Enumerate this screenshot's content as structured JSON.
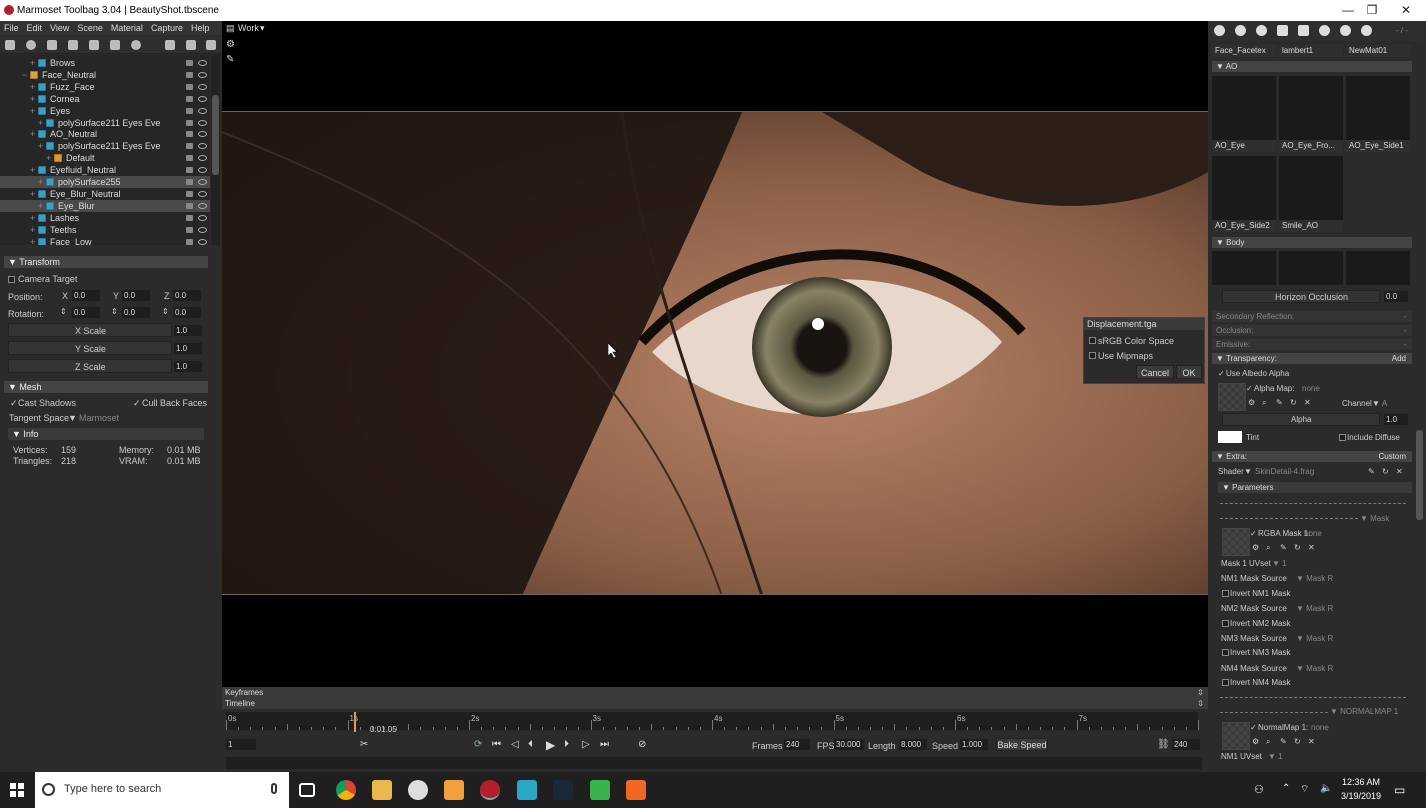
{
  "window": {
    "title": "Marmoset Toolbag 3.04  |  BeautyShot.tbscene",
    "controls": [
      "—",
      "❐",
      "✕"
    ]
  },
  "menu": [
    "File",
    "Edit",
    "View",
    "Scene",
    "Material",
    "Capture",
    "Help"
  ],
  "outliner": {
    "rows": [
      {
        "label": "Brows",
        "type": "mesh",
        "indent": 1,
        "selected": false
      },
      {
        "label": "Face_Neutral",
        "type": "folder",
        "indent": 0,
        "selected": false
      },
      {
        "label": "Fuzz_Face",
        "type": "mesh",
        "indent": 1,
        "selected": false
      },
      {
        "label": "Cornea",
        "type": "mesh",
        "indent": 1,
        "selected": false
      },
      {
        "label": "Eyes",
        "type": "mesh",
        "indent": 1,
        "selected": false
      },
      {
        "label": "polySurface211 Eyes Eve",
        "type": "mesh",
        "indent": 2,
        "selected": false
      },
      {
        "label": "AO_Neutral",
        "type": "mesh",
        "indent": 1,
        "selected": false
      },
      {
        "label": "polySurface211 Eyes Eve",
        "type": "mesh",
        "indent": 2,
        "selected": false
      },
      {
        "label": "Default",
        "type": "mat",
        "indent": 3,
        "selected": false
      },
      {
        "label": "Eyefluid_Neutral",
        "type": "mesh",
        "indent": 1,
        "selected": false
      },
      {
        "label": "polySurface255",
        "type": "mesh",
        "indent": 2,
        "selected": true
      },
      {
        "label": "Eye_Blur_Neutral",
        "type": "mesh",
        "indent": 1,
        "selected": false
      },
      {
        "label": "Eye_Blur",
        "type": "mesh",
        "indent": 2,
        "selected": true
      },
      {
        "label": "Lashes",
        "type": "mesh",
        "indent": 1,
        "selected": false
      },
      {
        "label": "Teeths",
        "type": "mesh",
        "indent": 1,
        "selected": false
      },
      {
        "label": "Face_Low",
        "type": "mesh",
        "indent": 1,
        "selected": false
      }
    ]
  },
  "transform": {
    "header": "Transform",
    "camera_target": "Camera Target",
    "position_label": "Position:",
    "rotation_label": "Rotation:",
    "x": "X",
    "y": "Y",
    "z": "Z",
    "pos": [
      "0.0",
      "0.0",
      "0.0"
    ],
    "rot": [
      "0.0",
      "0.0",
      "0.0"
    ],
    "xscale_label": "X Scale",
    "xscale": "1.0",
    "yscale_label": "Y Scale",
    "yscale": "1.0",
    "zscale_label": "Z Scale",
    "zscale": "1.0"
  },
  "mesh": {
    "header": "Mesh",
    "cast_shadows": "Cast Shadows",
    "cull_back_faces": "Cull Back Faces",
    "tangent_label": "Tangent Space",
    "tangent_value": "Marmoset",
    "info_header": "Info",
    "vertices_label": "Vertices:",
    "vertices": "159",
    "memory_label": "Memory:",
    "memory": "0.01 MB",
    "triangles_label": "Triangles:",
    "triangles": "218",
    "vram_label": "VRAM:",
    "vram": "0.01 MB"
  },
  "viewport": {
    "camera_menu": "Work"
  },
  "displacement_dialog": {
    "title": "Displacement.tga",
    "srgb": "sRGB Color Space",
    "mipmaps": "Use Mipmaps",
    "cancel": "Cancel",
    "ok": "OK"
  },
  "timeline": {
    "keyframes": "Keyframes",
    "timeline": "Timeline",
    "ticks": [
      "0s",
      "1s",
      "2s",
      "3s",
      "4s",
      "5s",
      "6s",
      "7s"
    ],
    "playhead_seconds": 1.05,
    "current_time": "0:01.05",
    "start_frame": "1",
    "frames_label": "Frames",
    "frames": "240",
    "fps_label": "FPS",
    "fps": "30.000",
    "length_label": "Length",
    "length": "8.000",
    "speed_label": "Speed",
    "speed": "1.000",
    "bake_speed": "Bake Speed",
    "end_frame": "240"
  },
  "materials": {
    "nav": "- / -",
    "top_labels": [
      "Face_Facetex",
      "lambert1",
      "NewMat01"
    ],
    "ao_group": "AO",
    "ao_labels": [
      "AO_Eye",
      "AO_Eye_Fro...",
      "AO_Eye_Side1"
    ],
    "ao_labels2": [
      "AO_Eye_Side2",
      "Smile_AO"
    ],
    "body_group": "Body"
  },
  "properties": {
    "horizon_occlusion": "Horizon Occlusion",
    "horizon_value": "0.0",
    "secondary_reflection": "Secondary Reflection:",
    "occlusion": "Occlusion:",
    "emissive": "Emissive:",
    "dash": "-",
    "transparency": "Transparency:",
    "transparency_mode": "Add",
    "use_albedo_alpha": "Use Albedo Alpha",
    "alpha_map": "Alpha Map:",
    "alpha_map_value": "none",
    "channel_label": "Channel",
    "channel_value": "A",
    "alpha_label": "Alpha",
    "alpha_value": "1.0",
    "tint_label": "Tint",
    "include_diffuse": "Include Diffuse",
    "extra": "Extra:",
    "extra_mode": "Custom",
    "shader_label": "Shader",
    "shader_value": "SkinDetail-4.frag",
    "parameters": "Parameters",
    "mask_group": "Mask",
    "rgba_mask": "RGBA Mask 1:",
    "rgba_mask_value": "none",
    "mask_uvset": "Mask 1 UVset",
    "mask_uvset_value": "1",
    "nm1_source": "NM1 Mask Source",
    "nm1_source_value": "Mask R",
    "invert_nm1": "Invert NM1 Mask",
    "nm2_source": "NM2 Mask Source",
    "nm2_source_value": "Mask R",
    "invert_nm2": "Invert NM2 Mask",
    "nm3_source": "NM3 Mask Source",
    "nm3_source_value": "Mask R",
    "invert_nm3": "Invert NM3 Mask",
    "nm4_source": "NM4 Mask Source",
    "nm4_source_value": "Mask R",
    "invert_nm4": "Invert NM4 Mask",
    "normalmap_group": "NORMALMAP 1",
    "normalmap": "NormalMap 1:",
    "normalmap_value": "none",
    "nm1_uvset": "NM1 UVset",
    "nm1_uvset_value": "1"
  },
  "taskbar": {
    "search_placeholder": "Type here to search",
    "time": "12:36 AM",
    "date": "3/19/2019"
  }
}
